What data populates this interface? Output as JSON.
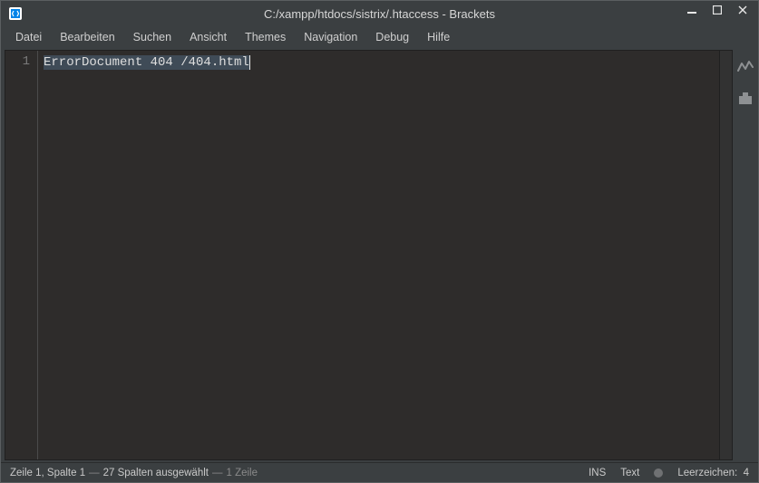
{
  "titlebar": {
    "title": "C:/xampp/htdocs/sistrix/.htaccess - Brackets"
  },
  "menu": {
    "items": [
      "Datei",
      "Bearbeiten",
      "Suchen",
      "Ansicht",
      "Themes",
      "Navigation",
      "Debug",
      "Hilfe"
    ]
  },
  "editor": {
    "lines": [
      {
        "num": "1",
        "text": "ErrorDocument 404 /404.html"
      }
    ]
  },
  "status": {
    "cursor": "Zeile 1, Spalte 1",
    "selection_sep": " — ",
    "selection": "27 Spalten ausgewählt",
    "lines_sep": " — ",
    "lines": "1 Zeile",
    "ins": "INS",
    "mode": "Text",
    "indent_label": "Leerzeichen:",
    "indent_value": "4"
  }
}
